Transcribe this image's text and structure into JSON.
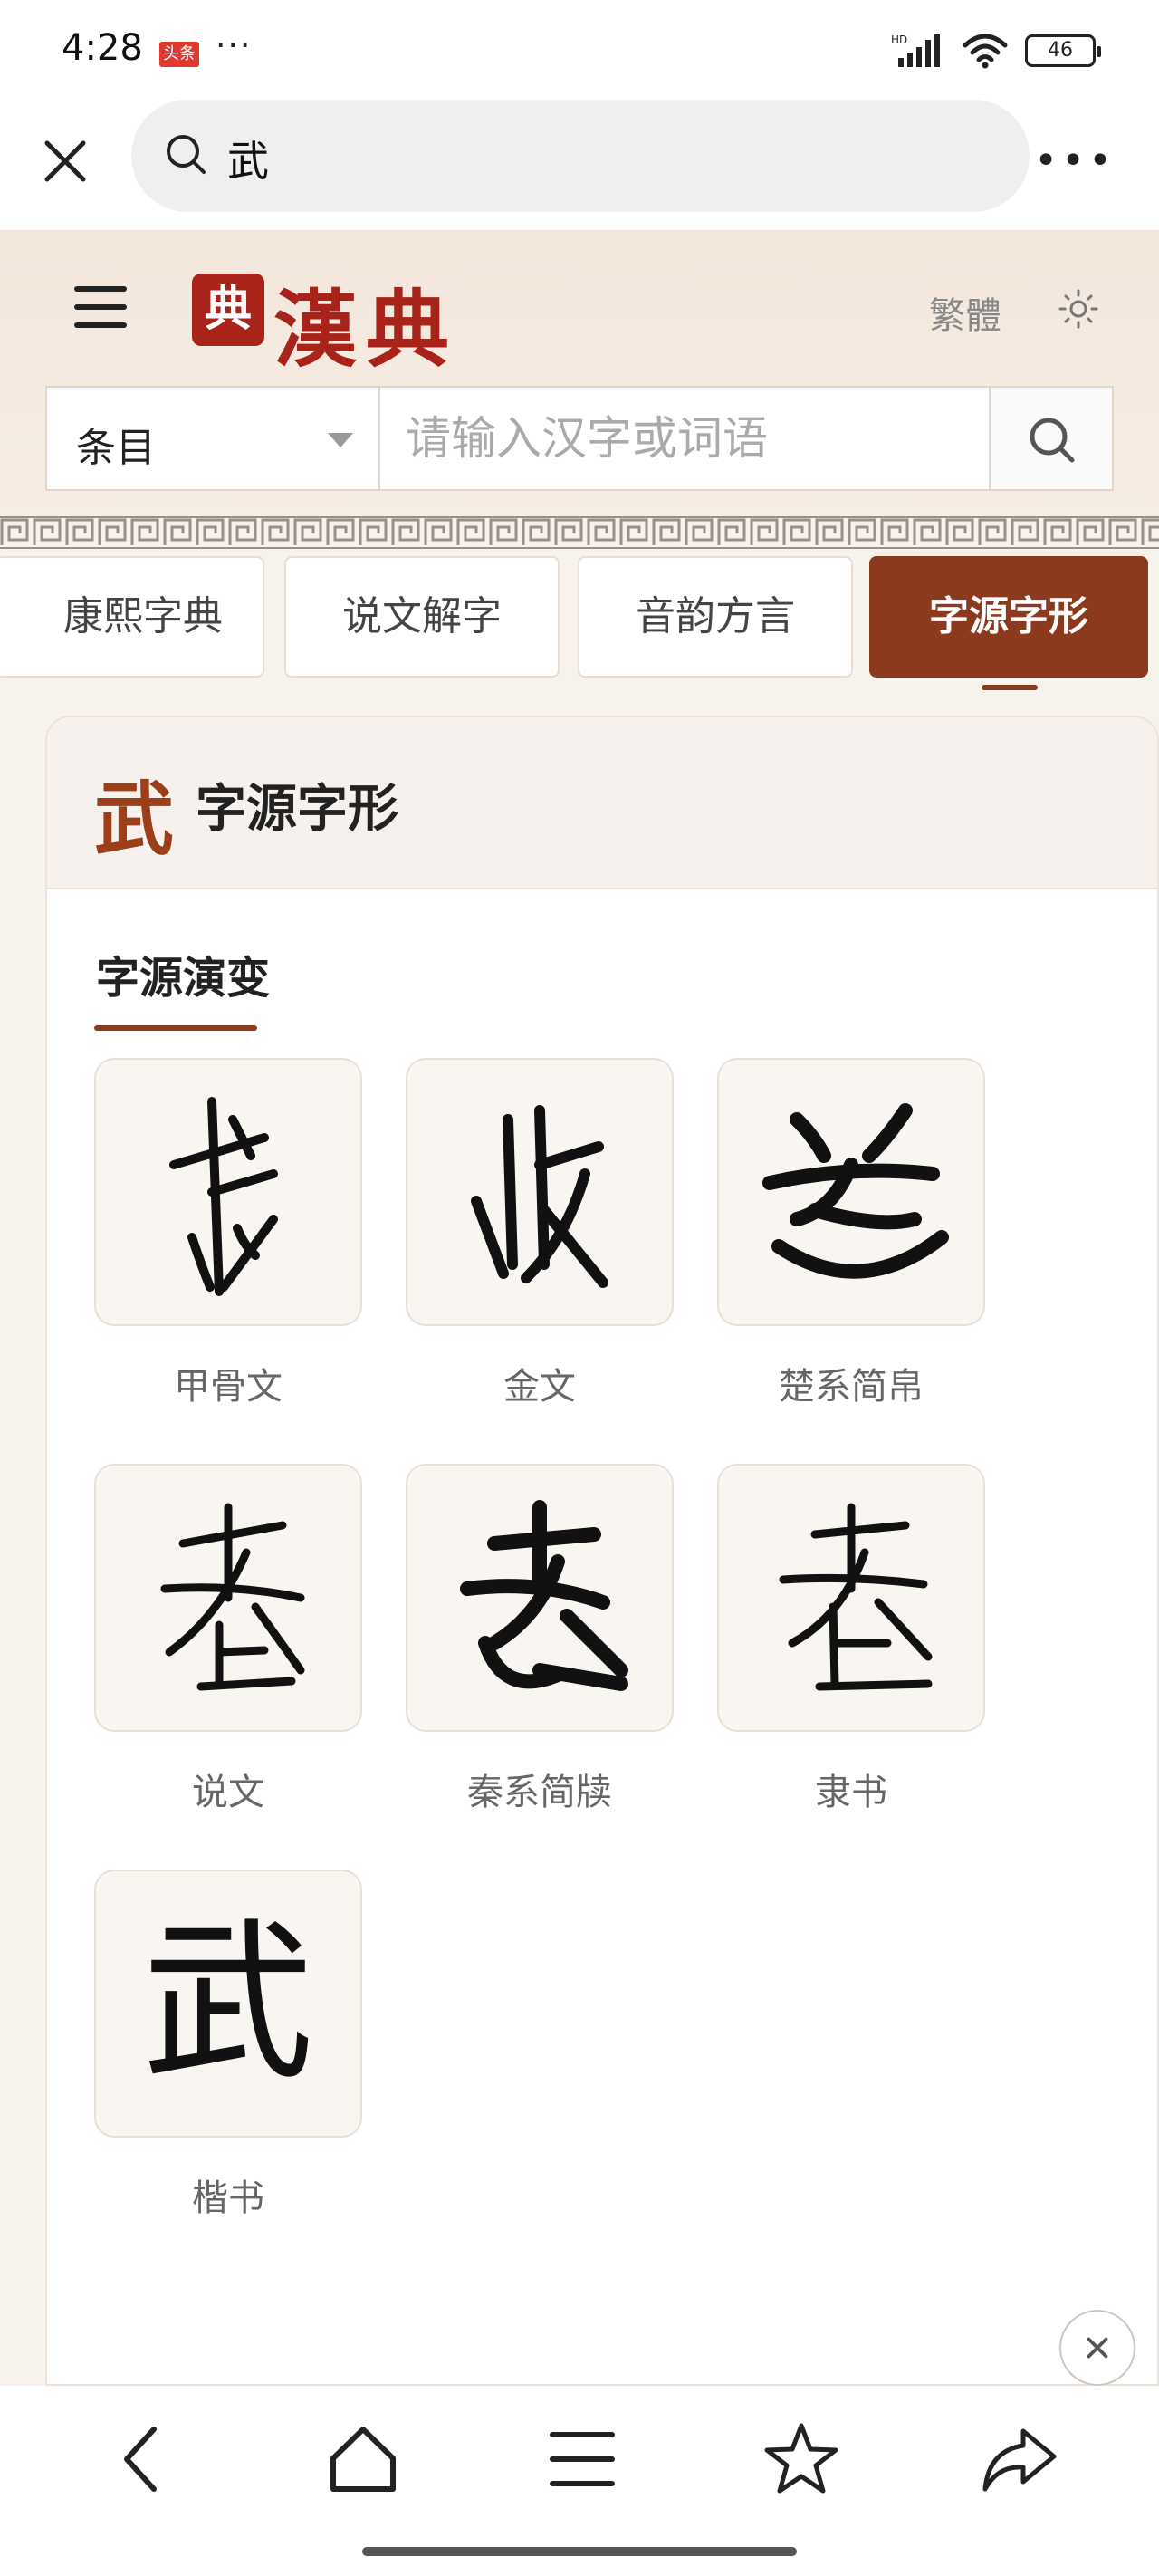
{
  "status_bar": {
    "time": "4:28",
    "app_badge": "头条",
    "more": "···",
    "network": "HD",
    "battery": "46"
  },
  "browser": {
    "query": "武"
  },
  "site": {
    "seal_char": "典",
    "logo_text": "漢典",
    "traditional_toggle": "繁體",
    "search": {
      "select_value": "条目",
      "placeholder": "请输入汉字或词语"
    }
  },
  "tabs": [
    {
      "label": "康熙字典",
      "active": false
    },
    {
      "label": "说文解字",
      "active": false
    },
    {
      "label": "音韵方言",
      "active": false
    },
    {
      "label": "字源字形",
      "active": true
    }
  ],
  "card": {
    "char": "武",
    "title": "字源字形",
    "section_title": "字源演变",
    "glyphs": [
      {
        "label": "甲骨文"
      },
      {
        "label": "金文"
      },
      {
        "label": "楚系简帛"
      },
      {
        "label": "说文"
      },
      {
        "label": "秦系简牍"
      },
      {
        "label": "隶书"
      },
      {
        "label": "楷书",
        "char": "武"
      }
    ]
  },
  "colors": {
    "accent": "#8c3a1d",
    "logo_red": "#a8241b"
  }
}
